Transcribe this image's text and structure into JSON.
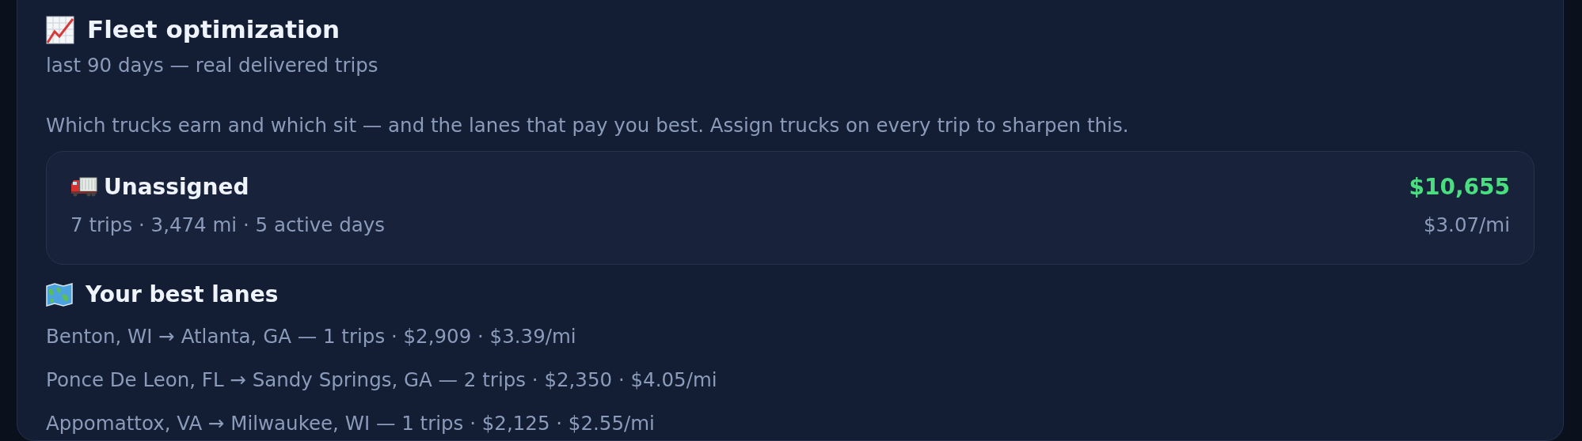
{
  "header": {
    "title": "Fleet optimization",
    "subtitle": "last 90 days — real delivered trips"
  },
  "description": "Which trucks earn and which sit — and the lanes that pay you best. Assign trucks on every trip to sharpen this.",
  "trucks": [
    {
      "name": "Unassigned",
      "stats": "7 trips · 3,474 mi · 5 active days",
      "revenue": "$10,655",
      "rate": "$3.07/mi"
    }
  ],
  "lanes": {
    "heading": "Your best lanes",
    "items": [
      "Benton, WI → Atlanta, GA — 1 trips · $2,909 · $3.39/mi",
      "Ponce De Leon, FL → Sandy Springs, GA — 2 trips · $2,350 · $4.05/mi",
      "Appomattox, VA → Milwaukee, WI — 1 trips · $2,125 · $2.55/mi"
    ]
  }
}
